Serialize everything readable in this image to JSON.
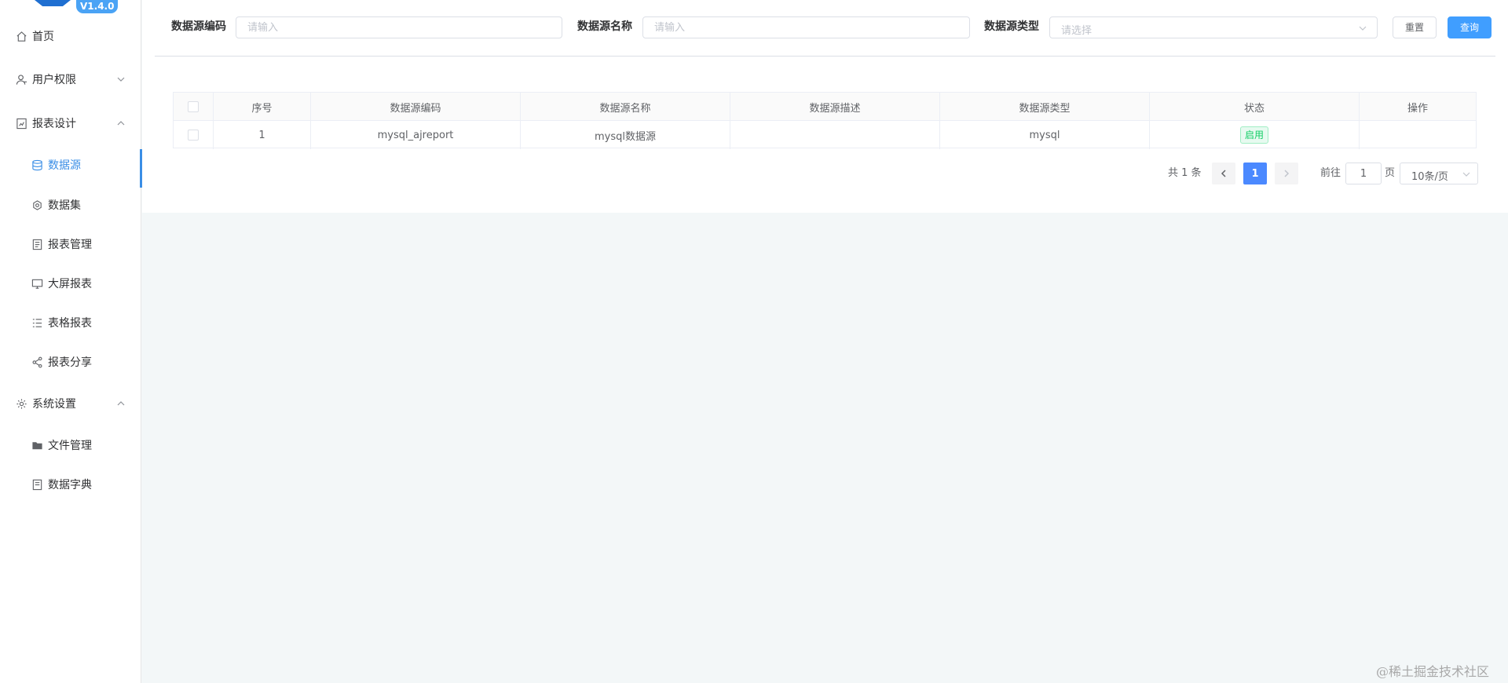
{
  "app": {
    "version": "V1.4.0"
  },
  "sidebar": {
    "items": [
      {
        "label": "首页",
        "icon": "home-icon"
      },
      {
        "label": "用户权限",
        "icon": "user-icon"
      },
      {
        "label": "报表设计",
        "icon": "report-design-icon"
      },
      {
        "label": "数据源",
        "icon": "database-icon",
        "active": true
      },
      {
        "label": "数据集",
        "icon": "dataset-icon"
      },
      {
        "label": "报表管理",
        "icon": "report-manage-icon"
      },
      {
        "label": "大屏报表",
        "icon": "screen-icon"
      },
      {
        "label": "表格报表",
        "icon": "list-icon"
      },
      {
        "label": "报表分享",
        "icon": "share-icon"
      },
      {
        "label": "系统设置",
        "icon": "gear-icon"
      },
      {
        "label": "文件管理",
        "icon": "folder-icon"
      },
      {
        "label": "数据字典",
        "icon": "dictionary-icon"
      }
    ]
  },
  "search": {
    "code_label": "数据源编码",
    "code_placeholder": "请输入",
    "name_label": "数据源名称",
    "name_placeholder": "请输入",
    "type_label": "数据源类型",
    "type_placeholder": "请选择",
    "reset_label": "重置",
    "query_label": "查询"
  },
  "table": {
    "columns": [
      "序号",
      "数据源编码",
      "数据源名称",
      "数据源描述",
      "数据源类型",
      "状态",
      "操作"
    ],
    "rows": [
      {
        "index": "1",
        "code": "mysql_ajreport",
        "name": "mysql数据源",
        "desc": "",
        "type": "mysql",
        "status": "启用",
        "action": ""
      }
    ]
  },
  "pagination": {
    "total": "共 1 条",
    "current": "1",
    "goto_label": "前往",
    "goto_value": "1",
    "page_suffix": "页",
    "page_size": "10条/页"
  },
  "watermark": "@稀土掘金技术社区",
  "colors": {
    "primary": "#409eff",
    "active": "#3a8ee6",
    "success": "#13ce66"
  }
}
